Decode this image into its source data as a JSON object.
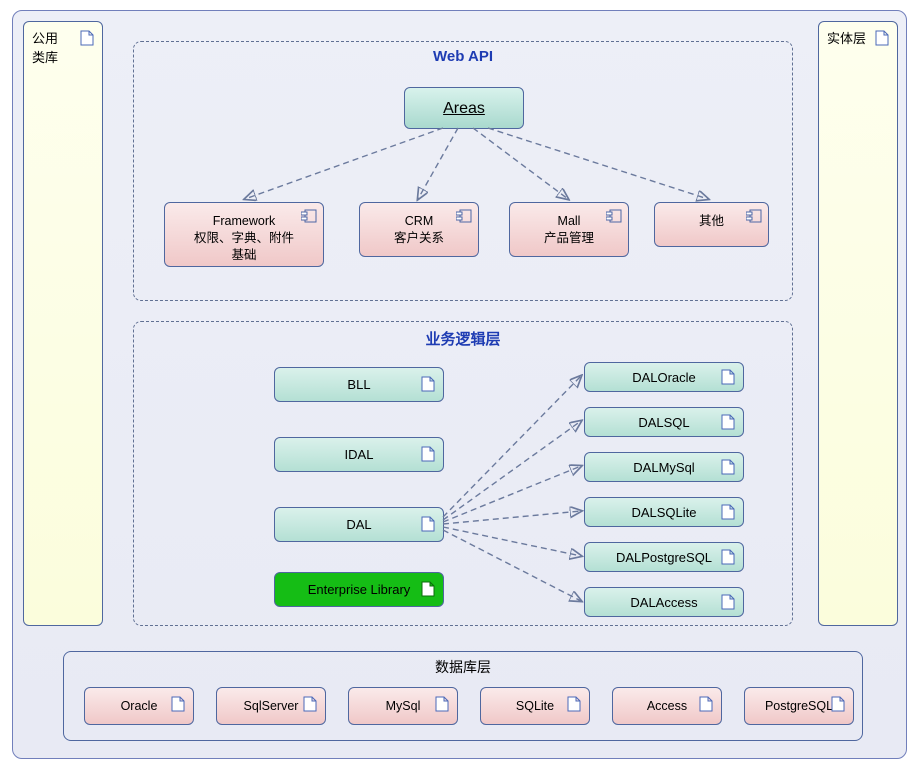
{
  "sides": {
    "left_title": "公用\n类库",
    "right_title": "实体层"
  },
  "webapi": {
    "title": "Web API",
    "areas_label": "Areas",
    "components": [
      {
        "title": "Framework",
        "sub": "权限、字典、附件\n基础"
      },
      {
        "title": "CRM",
        "sub": "客户关系"
      },
      {
        "title": "Mall",
        "sub": "产品管理"
      },
      {
        "title": "其他",
        "sub": ""
      }
    ]
  },
  "bll": {
    "title": "业务逻辑层",
    "left": [
      "BLL",
      "IDAL",
      "DAL"
    ],
    "lib": "Enterprise Library",
    "right": [
      "DALOracle",
      "DALSQL",
      "DALMySql",
      "DALSQLite",
      "DALPostgreSQL",
      "DALAccess"
    ]
  },
  "db": {
    "title": "数据库层",
    "items": [
      "Oracle",
      "SqlServer",
      "MySql",
      "SQLite",
      "Access",
      "PostgreSQL"
    ]
  }
}
